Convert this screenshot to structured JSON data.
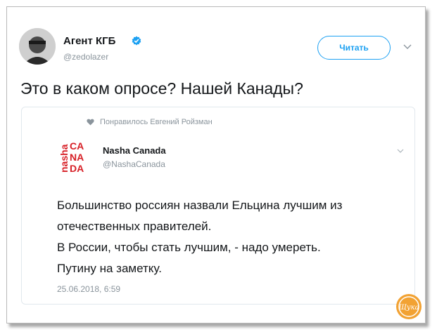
{
  "author": {
    "name": "Агент КГБ",
    "handle": "@zedolazer"
  },
  "follow_label": "Читать",
  "tweet_text": "Это в каком опросе? Нашей Канады?",
  "quoted": {
    "liked_by": "Понравилось Евгений Ройзман",
    "name": "Nasha Canada",
    "handle": "@NashaCanada",
    "logo_text": "nasha CANADA",
    "body_lines": [
      "Большинство россиян назвали Ельцина лучшим из",
      "отечественных правителей.",
      "В России, чтобы стать лучшим, - надо умереть.",
      "Путину на заметку."
    ],
    "date": "25.06.2018, 6:59"
  },
  "watermark_text": "Щука",
  "colors": {
    "accent": "#1da1f2",
    "logo_red": "#d71f26",
    "muted": "#8a949c",
    "watermark": "#f2a233"
  },
  "icons": [
    "verified-badge-icon",
    "chevron-down-icon",
    "heart-icon",
    "logo-icon",
    "watermark-icon"
  ]
}
